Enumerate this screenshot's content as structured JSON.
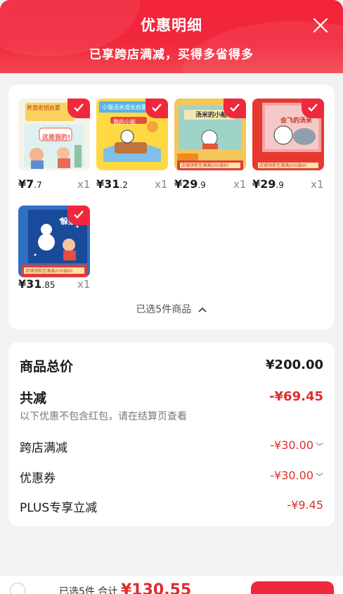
{
  "header": {
    "title": "优惠明细",
    "subtitle": "已享跨店满减，买得多省得多"
  },
  "products": [
    {
      "price_int": "¥7",
      "price_dec": ".7",
      "qty": "x1"
    },
    {
      "price_int": "¥31",
      "price_dec": ".2",
      "qty": "x1"
    },
    {
      "price_int": "¥29",
      "price_dec": ".9",
      "qty": "x1"
    },
    {
      "price_int": "¥29",
      "price_dec": ".9",
      "qty": "x1"
    },
    {
      "price_int": "¥31",
      "price_dec": ".85",
      "qty": "x1"
    }
  ],
  "product_covers": [
    {
      "top_text": "养育密钥启蒙",
      "title": "这是我的!"
    },
    {
      "top_text": "小猫汤米成长启蒙",
      "title": "我的小船"
    },
    {
      "top_text": "",
      "title": "汤米的小船"
    },
    {
      "top_text": "",
      "title": "会飞的汤米"
    },
    {
      "top_text": "",
      "title": "躲猫猫"
    }
  ],
  "promo_strip": "店铺领券至满满200减60",
  "selected_text": "已选5件商品",
  "summary": {
    "total_label": "商品总价",
    "total_value": "¥200.00",
    "reduce_label": "共减",
    "reduce_value": "-¥69.45",
    "note": "以下优惠不包含红包，请在结算页查看",
    "items": [
      {
        "label": "跨店满减",
        "value": "-¥30.00"
      },
      {
        "label": "优惠券",
        "value": "-¥30.00"
      },
      {
        "label": "PLUS专享立减",
        "value": "-¥9.45"
      }
    ]
  },
  "bottom": {
    "text": "已选5件 合计",
    "price": "¥130.55"
  },
  "colors": {
    "brand_red": "#f0283c",
    "price_red": "#e02d2d"
  }
}
